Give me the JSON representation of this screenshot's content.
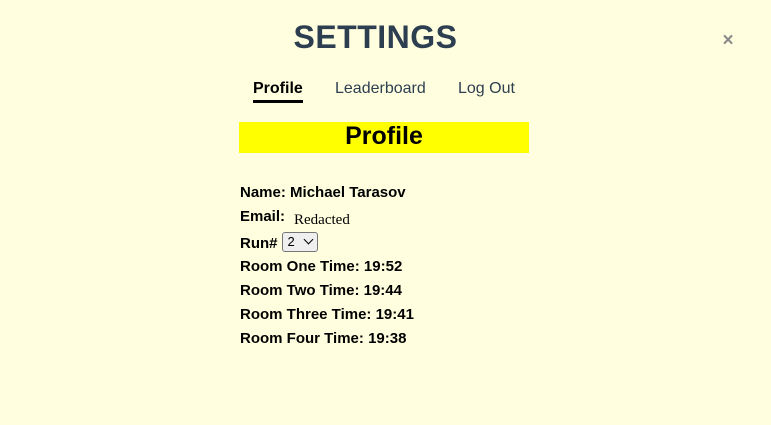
{
  "header": {
    "title": "SETTINGS",
    "close_glyph": "×"
  },
  "tabs": [
    {
      "label": "Profile",
      "active": true
    },
    {
      "label": "Leaderboard",
      "active": false
    },
    {
      "label": "Log Out",
      "active": false
    }
  ],
  "profile": {
    "heading": "Profile",
    "name_label": "Name:",
    "name_value": "Michael Tarasov",
    "email_label": "Email:",
    "email_value": "Redacted",
    "run_label": "Run#",
    "run_selected": "2",
    "rooms": [
      {
        "label": "Room One Time:",
        "value": "19:52"
      },
      {
        "label": "Room Two Time:",
        "value": "19:44"
      },
      {
        "label": "Room Three Time:",
        "value": "19:41"
      },
      {
        "label": "Room Four Time:",
        "value": "19:38"
      }
    ]
  },
  "colors": {
    "background": "#ffffe0",
    "heading_highlight": "#ffff00",
    "title": "#2c3e50",
    "close_icon": "#8a8a8a"
  },
  "icons": {
    "close": "close-icon",
    "dropdown": "chevron-down-icon"
  }
}
